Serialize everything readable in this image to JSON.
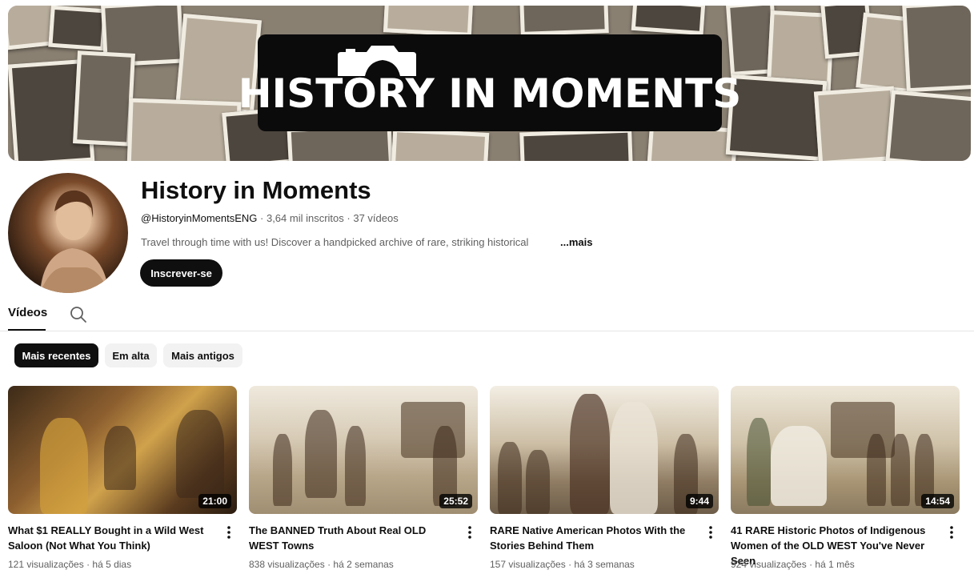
{
  "banner": {
    "logo_text": "HISTORY IN MOMENTS"
  },
  "channel": {
    "name": "History in Moments",
    "handle": "@HistoryinMomentsENG",
    "separator": " · ",
    "subscribers": "3,64 mil inscritos",
    "video_count": "37 vídeos",
    "description": "Travel through time with us! Discover a handpicked archive of rare, striking historical",
    "more_label": "...mais",
    "subscribe_label": "Inscrever-se"
  },
  "tabs": {
    "videos_label": "Vídeos"
  },
  "chips": [
    {
      "label": "Mais recentes",
      "selected": true
    },
    {
      "label": "Em alta",
      "selected": false
    },
    {
      "label": "Mais antigos",
      "selected": false
    }
  ],
  "videos": [
    {
      "title": "What $1 REALLY Bought in a Wild West Saloon (Not What You Think)",
      "duration": "21:00",
      "views": "121 visualizações",
      "age": "há 5 dias"
    },
    {
      "title": "The BANNED Truth About Real OLD WEST Towns",
      "duration": "25:52",
      "views": "838 visualizações",
      "age": "há 2 semanas"
    },
    {
      "title": "RARE Native American Photos With the Stories Behind Them",
      "duration": "9:44",
      "views": "157 visualizações",
      "age": "há 3 semanas"
    },
    {
      "title": "41 RARE Historic Photos of Indigenous Women of the OLD WEST You've Never Seen",
      "duration": "14:54",
      "views": "924 visualizações",
      "age": "há 1 mês"
    }
  ],
  "colors": {
    "text_primary": "#0f0f0f",
    "text_secondary": "#606060",
    "chip_bg": "#f2f2f2",
    "chip_active_bg": "#0f0f0f",
    "divider": "#e5e5e5"
  }
}
